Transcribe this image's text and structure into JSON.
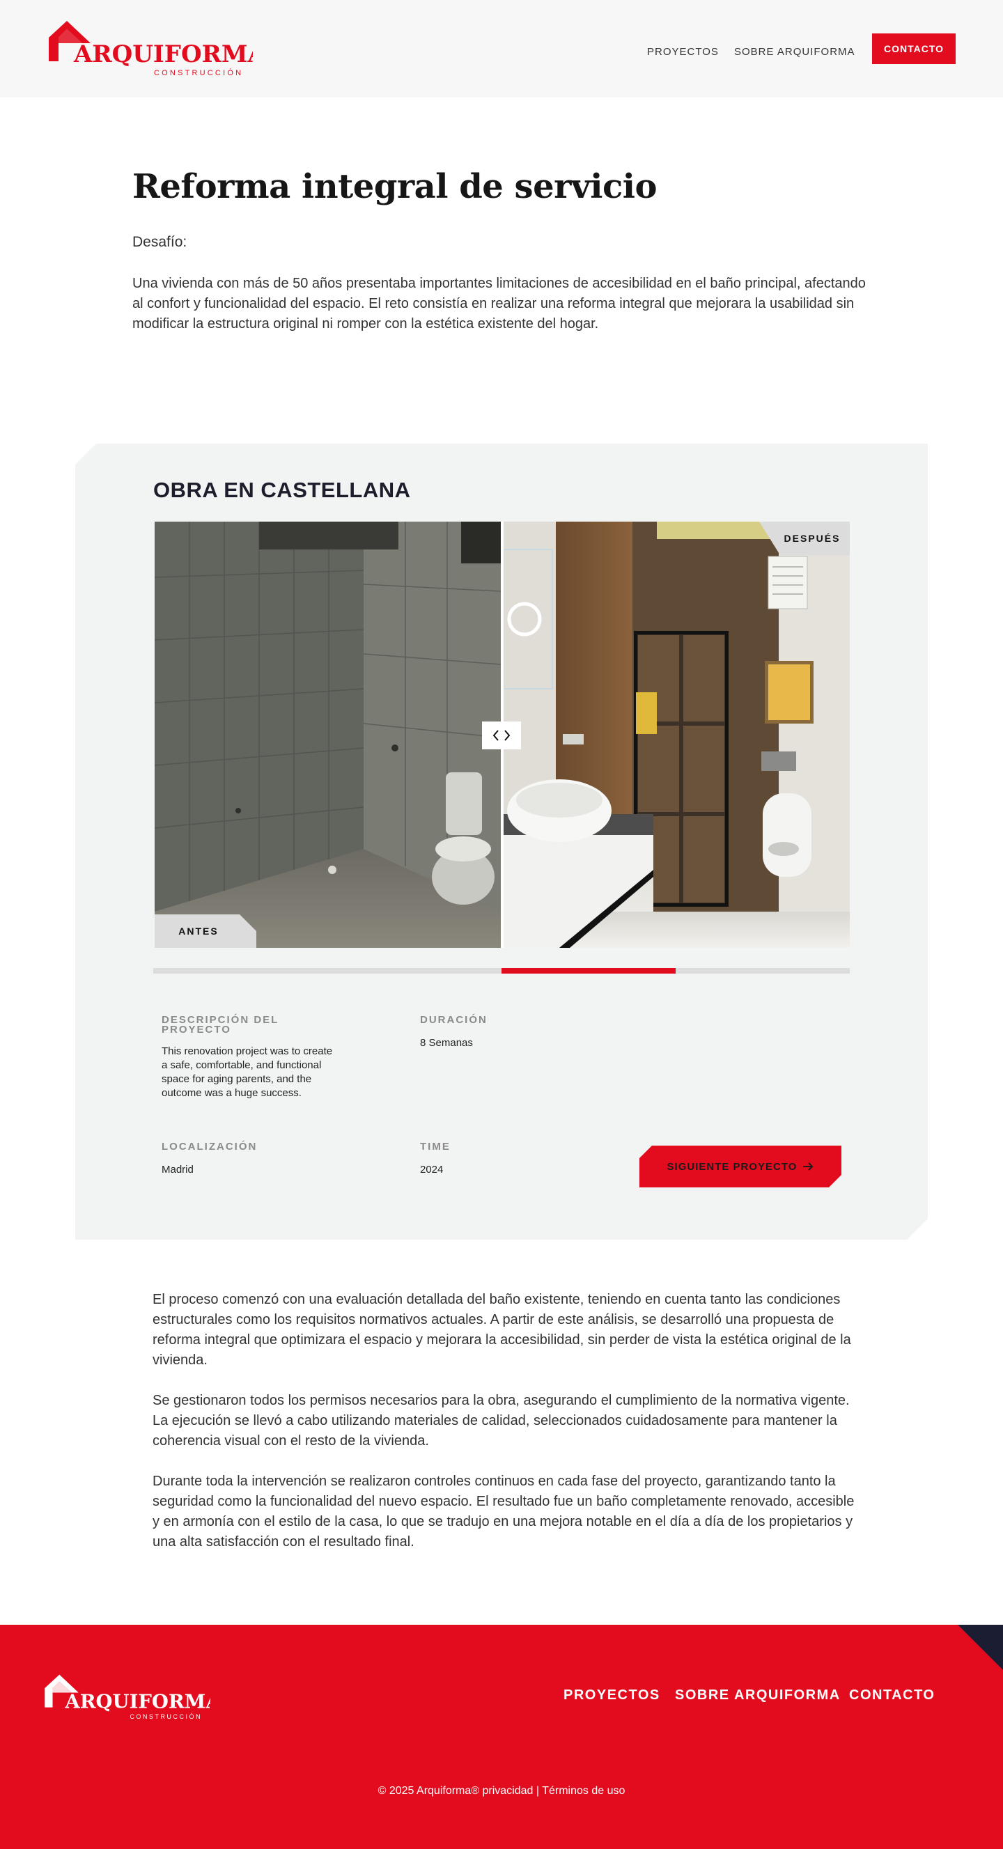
{
  "brand": {
    "name": "ARQUIFORMA",
    "tagline": "CONSTRUCCIÓN",
    "primary_color": "#e30c1e",
    "dark_color": "#1b1e33"
  },
  "header": {
    "nav": [
      "PROYECTOS",
      "SOBRE ARQUIFORMA"
    ],
    "contact_label": "CONTACTO"
  },
  "intro": {
    "title": "Reforma integral de servicio",
    "challenge_label": "Desafío:",
    "challenge_text": "Una vivienda con más de 50 años presentaba importantes limitaciones de accesibilidad en el baño principal, afectando al confort y funcionalidad del espacio. El reto consistía en realizar una reforma integral que mejorara la usabilidad sin modificar la estructura original ni romper con la estética existente del hogar."
  },
  "project": {
    "title": "OBRA EN CASTELLANA",
    "after_label": "DESPUÉS",
    "before_label": "ANTES",
    "slider_progress": 0.25,
    "description_label": "DESCRIPCIÓN DEL PROYECTO",
    "description_text": "This renovation project was to create a safe, comfortable, and functional space for aging parents, and the outcome was a huge success.",
    "duration_label": "DURACIÓN",
    "duration_value": "8 Semanas",
    "location_label": "LOCALIZACIÓN",
    "location_value": "Madrid",
    "time_label": "TIME",
    "time_value": "2024",
    "next_label": "SIGUIENTE PROYECTO"
  },
  "body": {
    "paragraphs": [
      "El proceso comenzó con una evaluación detallada del baño existente, teniendo en cuenta tanto las condiciones estructurales como los requisitos normativos actuales. A partir de este análisis, se desarrolló una propuesta de reforma integral que optimizara el espacio y mejorara la accesibilidad, sin perder de vista la estética original de la vivienda.",
      "Se gestionaron todos los permisos necesarios para la obra, asegurando el cumplimiento de la normativa vigente. La ejecución se llevó a cabo utilizando materiales de calidad, seleccionados cuidadosamente para mantener la coherencia visual con el resto de la vivienda.",
      "Durante toda la intervención se realizaron controles continuos en cada fase del proyecto, garantizando tanto la seguridad como la funcionalidad del nuevo espacio. El resultado fue un baño completamente renovado, accesible y en armonía con el estilo de la casa, lo que se tradujo en una mejora notable en el día a día de los propietarios y una alta satisfacción con el resultado final."
    ]
  },
  "footer": {
    "nav": [
      "PROYECTOS",
      "SOBRE ARQUIFORMA",
      "CONTACTO"
    ],
    "copyright": "© 2025 Arquiforma® ",
    "privacy": "privacidad",
    "separator": " | ",
    "terms": "Términos de uso"
  }
}
